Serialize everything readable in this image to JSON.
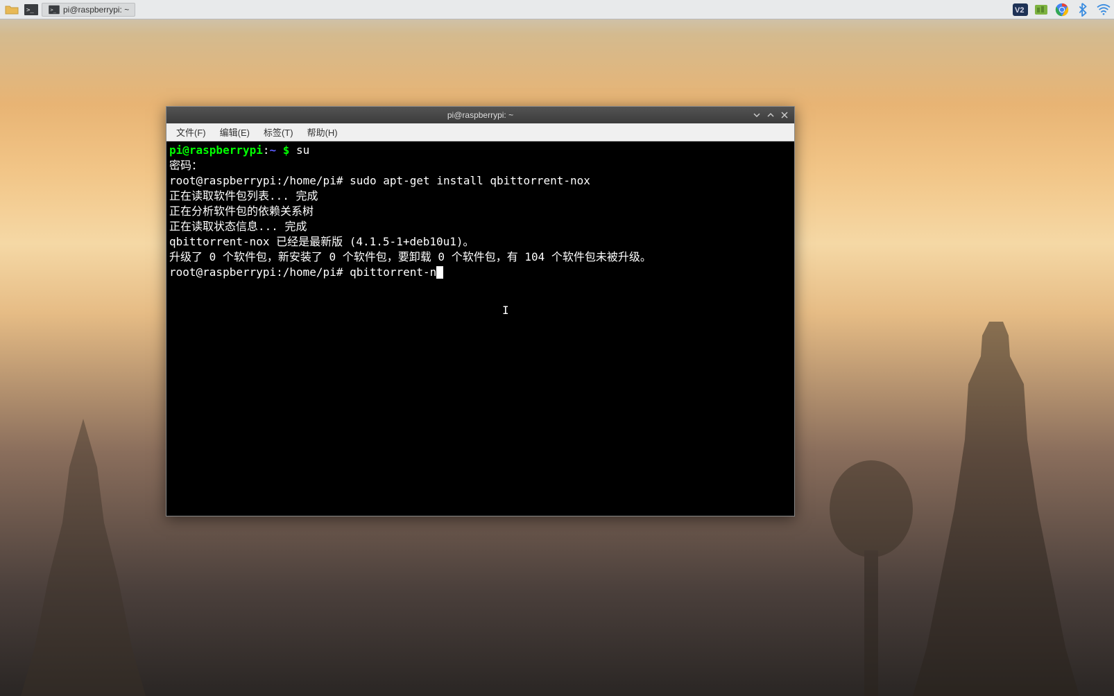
{
  "taskbar": {
    "app_label": "pi@raspberrypi: ~"
  },
  "systray": {
    "vnc_label": "V2"
  },
  "terminal": {
    "title": "pi@raspberrypi: ~",
    "menu": {
      "file": "文件(F)",
      "edit": "编辑(E)",
      "tabs": "标签(T)",
      "help": "帮助(H)"
    },
    "lines": {
      "prompt1_userhost": "pi@raspberrypi",
      "prompt1_sep": ":",
      "prompt1_path": "~",
      "prompt1_dollar": " $ ",
      "prompt1_cmd": "su",
      "password_line": "密码：",
      "prompt2": "root@raspberrypi:/home/pi# sudo apt-get install qbittorrent-nox",
      "output1": "正在读取软件包列表... 完成",
      "output2": "正在分析软件包的依赖关系树       ",
      "output3": "正在读取状态信息... 完成       ",
      "output4": "qbittorrent-nox 已经是最新版 (4.1.5-1+deb10u1)。",
      "output5": "升级了 0 个软件包，新安装了 0 个软件包，要卸载 0 个软件包，有 104 个软件包未被升级。",
      "prompt3": "root@raspberrypi:/home/pi# qbittorrent-n"
    }
  }
}
